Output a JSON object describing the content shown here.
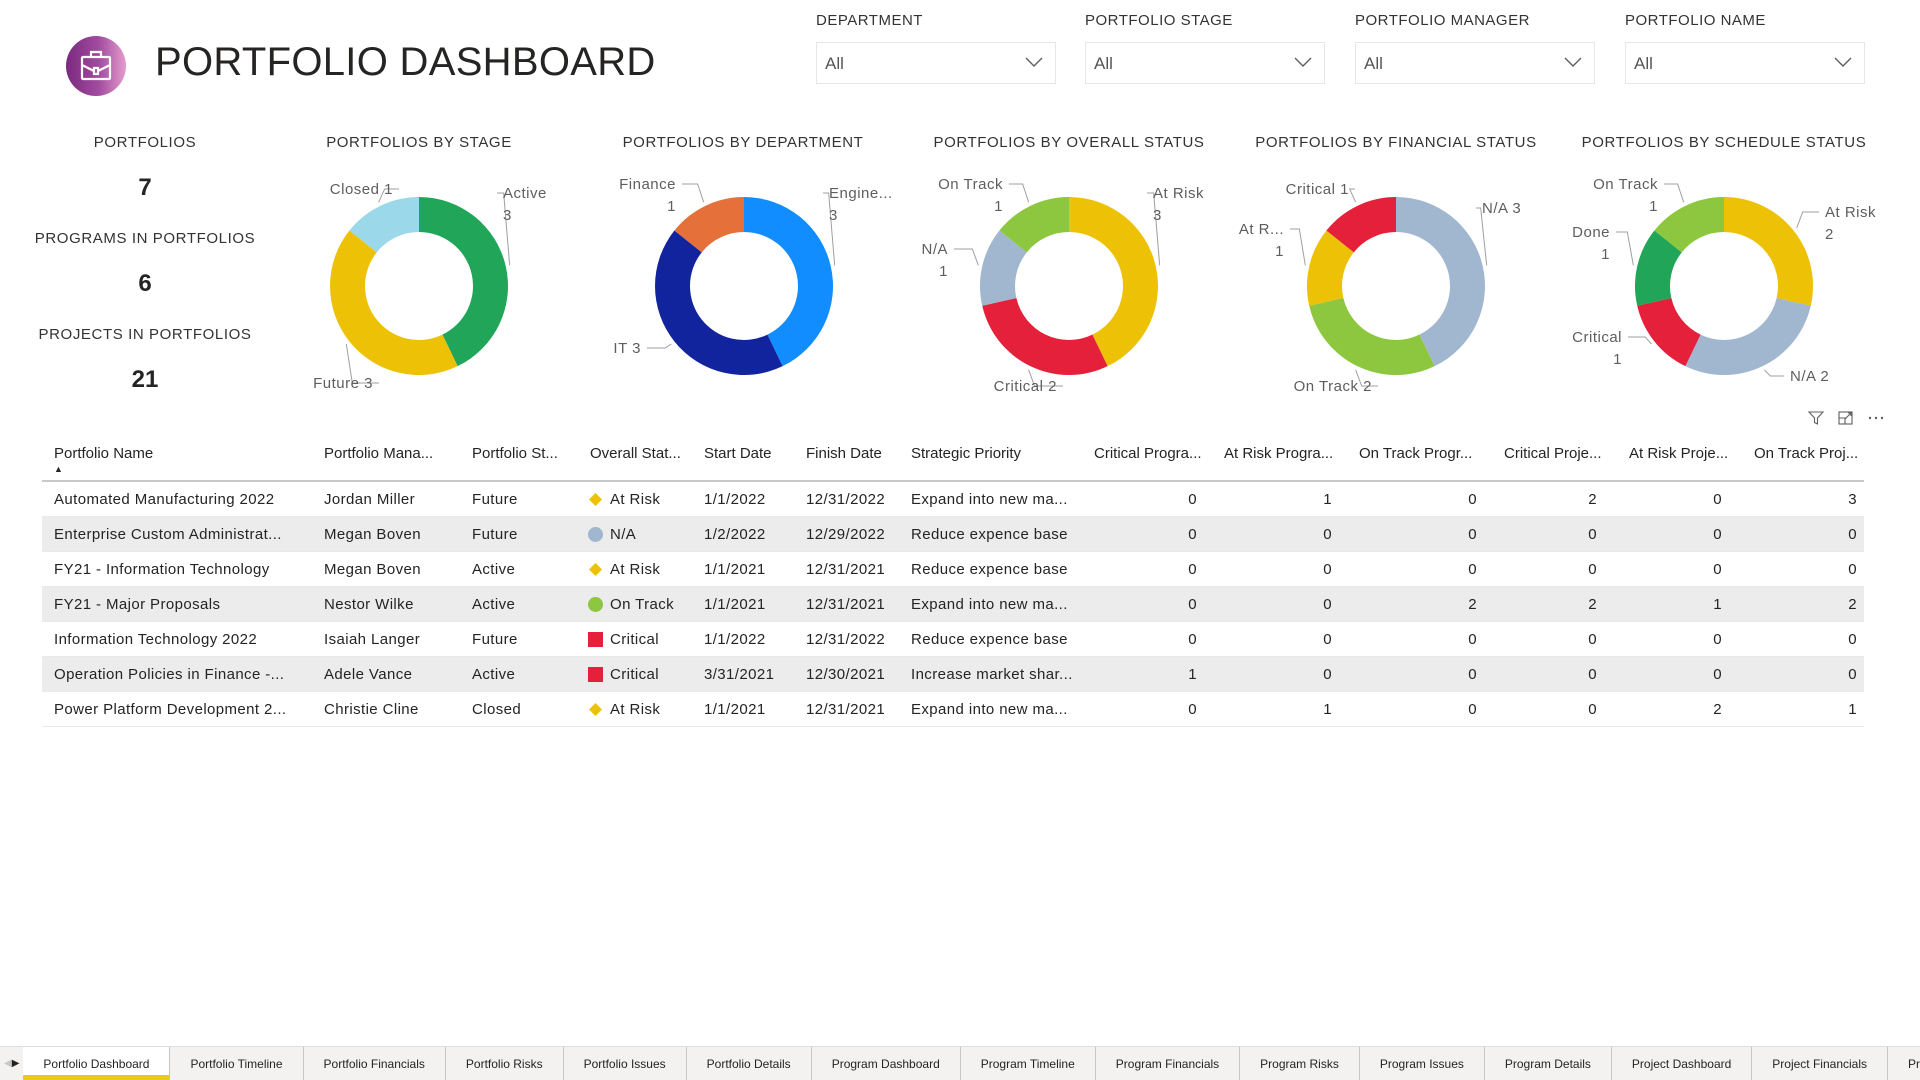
{
  "header": {
    "title": "PORTFOLIO DASHBOARD",
    "logo_icon": "briefcase-icon"
  },
  "slicers": [
    {
      "label": "DEPARTMENT",
      "value": "All"
    },
    {
      "label": "PORTFOLIO STAGE",
      "value": "All"
    },
    {
      "label": "PORTFOLIO MANAGER",
      "value": "All"
    },
    {
      "label": "PORTFOLIO NAME",
      "value": "All"
    }
  ],
  "kpis": [
    {
      "label": "PORTFOLIOS",
      "value": "7"
    },
    {
      "label": "PROGRAMS IN PORTFOLIOS",
      "value": "6"
    },
    {
      "label": "PROJECTS IN PORTFOLIOS",
      "value": "21"
    }
  ],
  "colors": {
    "green": "#21a659",
    "lightblue": "#9bd8ea",
    "yellow": "#edc106",
    "orange": "#e5703a",
    "blue": "#118dff",
    "navy": "#12239e",
    "lime": "#8dc63f",
    "gray": "#a0b7cf",
    "red": "#e5203a",
    "tab_accent": "#f2c811"
  },
  "chart_data": [
    {
      "type": "pie",
      "title": "PORTFOLIOS BY STAGE",
      "categories": [
        "Active",
        "Future",
        "Closed"
      ],
      "values": [
        3,
        3,
        1
      ],
      "labels": [
        [
          "Active",
          "3"
        ],
        [
          "Future 3"
        ],
        [
          "Closed 1"
        ]
      ],
      "colors": [
        "#21a659",
        "#edc106",
        "#9bd8ea"
      ]
    },
    {
      "type": "pie",
      "title": "PORTFOLIOS BY DEPARTMENT",
      "categories": [
        "Engineering",
        "IT",
        "Finance"
      ],
      "values": [
        3,
        3,
        1
      ],
      "labels": [
        [
          "Engine...",
          "3"
        ],
        [
          "IT 3"
        ],
        [
          "Finance",
          "1"
        ]
      ],
      "colors": [
        "#118dff",
        "#12239e",
        "#e5703a"
      ]
    },
    {
      "type": "pie",
      "title": "PORTFOLIOS BY OVERALL STATUS",
      "categories": [
        "At Risk",
        "Critical",
        "N/A",
        "On Track"
      ],
      "values": [
        3,
        2,
        1,
        1
      ],
      "labels": [
        [
          "At Risk",
          "3"
        ],
        [
          "Critical 2"
        ],
        [
          "N/A",
          "1"
        ],
        [
          "On Track",
          "1"
        ]
      ],
      "colors": [
        "#edc106",
        "#e5203a",
        "#a0b7cf",
        "#8dc63f"
      ]
    },
    {
      "type": "pie",
      "title": "PORTFOLIOS BY FINANCIAL STATUS",
      "categories": [
        "N/A",
        "On Track",
        "At Risk",
        "Critical"
      ],
      "values": [
        3,
        2,
        1,
        1
      ],
      "labels": [
        [
          "N/A 3"
        ],
        [
          "On Track 2"
        ],
        [
          "At R...",
          "1"
        ],
        [
          "Critical 1"
        ]
      ],
      "colors": [
        "#a0b7cf",
        "#8dc63f",
        "#edc106",
        "#e5203a"
      ]
    },
    {
      "type": "pie",
      "title": "PORTFOLIOS BY SCHEDULE STATUS",
      "categories": [
        "At Risk",
        "N/A",
        "Critical",
        "Done",
        "On Track"
      ],
      "values": [
        2,
        2,
        1,
        1,
        1
      ],
      "labels": [
        [
          "At Risk",
          "2"
        ],
        [
          "N/A 2"
        ],
        [
          "Critical",
          "1"
        ],
        [
          "Done",
          "1"
        ],
        [
          "On Track",
          "1"
        ]
      ],
      "colors": [
        "#edc106",
        "#a0b7cf",
        "#e5203a",
        "#21a659",
        "#8dc63f"
      ]
    }
  ],
  "table": {
    "columns": [
      "Portfolio Name",
      "Portfolio Mana...",
      "Portfolio St...",
      "Overall Stat...",
      "Start Date",
      "Finish Date",
      "Strategic Priority",
      "Critical Progra...",
      "At Risk Progra...",
      "On Track Progr...",
      "Critical Proje...",
      "At Risk Proje...",
      "On Track Proj..."
    ],
    "sort_indicator": "▲",
    "rows": [
      {
        "name": "Automated Manufacturing 2022",
        "manager": "Jordan Miller",
        "stage": "Future",
        "status": "At Risk",
        "status_icon": "diamond",
        "start": "1/1/2022",
        "finish": "12/31/2022",
        "priority": "Expand into new ma...",
        "nums": [
          "0",
          "1",
          "0",
          "2",
          "0",
          "3"
        ]
      },
      {
        "name": "Enterprise Custom Administrat...",
        "manager": "Megan Boven",
        "stage": "Future",
        "status": "N/A",
        "status_icon": "circle-gray",
        "start": "1/2/2022",
        "finish": "12/29/2022",
        "priority": "Reduce expence base",
        "nums": [
          "0",
          "0",
          "0",
          "0",
          "0",
          "0"
        ]
      },
      {
        "name": "FY21 - Information Technology",
        "manager": "Megan Boven",
        "stage": "Active",
        "status": "At Risk",
        "status_icon": "diamond",
        "start": "1/1/2021",
        "finish": "12/31/2021",
        "priority": "Reduce expence base",
        "nums": [
          "0",
          "0",
          "0",
          "0",
          "0",
          "0"
        ]
      },
      {
        "name": "FY21 - Major Proposals",
        "manager": "Nestor Wilke",
        "stage": "Active",
        "status": "On Track",
        "status_icon": "circle-green",
        "start": "1/1/2021",
        "finish": "12/31/2021",
        "priority": "Expand into new ma...",
        "nums": [
          "0",
          "0",
          "2",
          "2",
          "1",
          "2"
        ]
      },
      {
        "name": "Information Technology 2022",
        "manager": "Isaiah Langer",
        "stage": "Future",
        "status": "Critical",
        "status_icon": "square",
        "start": "1/1/2022",
        "finish": "12/31/2022",
        "priority": "Reduce expence base",
        "nums": [
          "0",
          "0",
          "0",
          "0",
          "0",
          "0"
        ]
      },
      {
        "name": "Operation Policies in Finance -...",
        "manager": "Adele Vance",
        "stage": "Active",
        "status": "Critical",
        "status_icon": "square",
        "start": "3/31/2021",
        "finish": "12/30/2021",
        "priority": "Increase market shar...",
        "nums": [
          "1",
          "0",
          "0",
          "0",
          "0",
          "0"
        ]
      },
      {
        "name": "Power Platform Development 2...",
        "manager": "Christie Cline",
        "stage": "Closed",
        "status": "At Risk",
        "status_icon": "diamond",
        "start": "1/1/2021",
        "finish": "12/31/2021",
        "priority": "Expand into new ma...",
        "nums": [
          "0",
          "1",
          "0",
          "0",
          "2",
          "1"
        ]
      }
    ]
  },
  "visual_header_icons": [
    "filter-icon",
    "focus-mode-icon",
    "more-options-icon"
  ],
  "tabs": [
    {
      "label": "Portfolio Dashboard",
      "active": true
    },
    {
      "label": "Portfolio Timeline"
    },
    {
      "label": "Portfolio Financials"
    },
    {
      "label": "Portfolio Risks"
    },
    {
      "label": "Portfolio Issues"
    },
    {
      "label": "Portfolio Details"
    },
    {
      "label": "Program Dashboard"
    },
    {
      "label": "Program Timeline"
    },
    {
      "label": "Program Financials"
    },
    {
      "label": "Program Risks"
    },
    {
      "label": "Program Issues"
    },
    {
      "label": "Program Details"
    },
    {
      "label": "Project Dashboard"
    },
    {
      "label": "Project Financials"
    },
    {
      "label": "Pro"
    }
  ]
}
